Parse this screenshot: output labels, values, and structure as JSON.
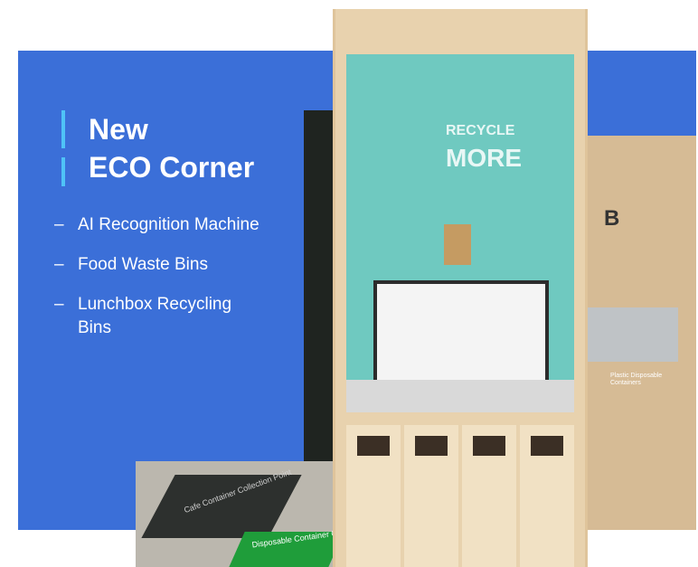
{
  "colors": {
    "panel_blue": "#3b6fd8",
    "accent_cyan": "#4fc3f7",
    "text_white": "#ffffff"
  },
  "heading": {
    "line1": "New",
    "line2": "ECO Corner"
  },
  "features": [
    {
      "dash": "–",
      "text": "AI Recognition Machine"
    },
    {
      "dash": "–",
      "text": "Food Waste Bins"
    },
    {
      "dash": "–",
      "text": "Lunchbox Recycling Bins"
    }
  ],
  "photo": {
    "kiosk_sign_line1": "RECYCLE",
    "kiosk_sign_line2": "MORE",
    "floor_sign_dark": "Cafe Container Collection Point",
    "floor_sign_green": "Disposable Container Collection Point",
    "stall_letter": "B",
    "stall_sign": "Plastic Disposable Containers"
  }
}
